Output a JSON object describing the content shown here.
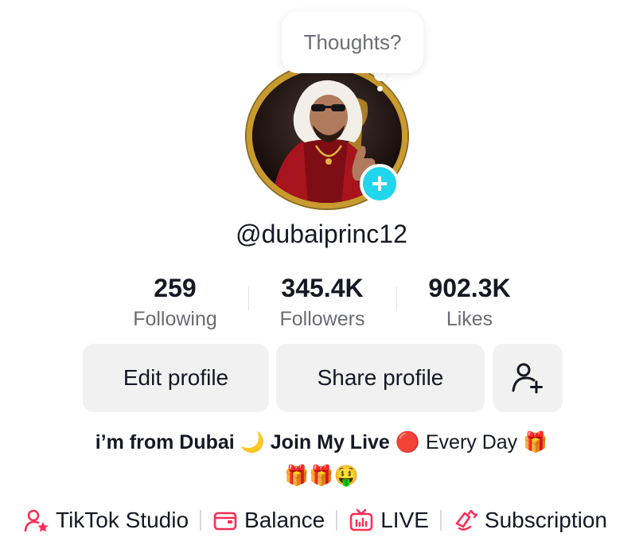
{
  "profile": {
    "thought_bubble": "Thoughts?",
    "username": "@dubaiprinc12",
    "add_story_symbol": "+"
  },
  "stats": [
    {
      "value": "259",
      "label": "Following"
    },
    {
      "value": "345.4K",
      "label": "Followers"
    },
    {
      "value": "902.3K",
      "label": "Likes"
    }
  ],
  "actions": {
    "edit_profile": "Edit profile",
    "share_profile": "Share profile"
  },
  "bio": {
    "part1": "i’m from Dubai",
    "moon": "🌙",
    "part2": "Join My Live",
    "red_circle": "🔴",
    "part3": "Every Day",
    "gift": "🎁",
    "line2": "🎁🎁🤑"
  },
  "links": [
    {
      "label": "TikTok Studio",
      "icon": "person-star-icon"
    },
    {
      "label": "Balance",
      "icon": "wallet-icon"
    },
    {
      "label": "LIVE",
      "icon": "live-tv-icon"
    },
    {
      "label": "Subscription",
      "icon": "subscription-icon"
    }
  ],
  "colors": {
    "accent_pink": "#fe2c55",
    "add_button_cyan": "#20d5ec",
    "avatar_gold": "#c99a2e",
    "button_bg": "#f1f1f2"
  }
}
